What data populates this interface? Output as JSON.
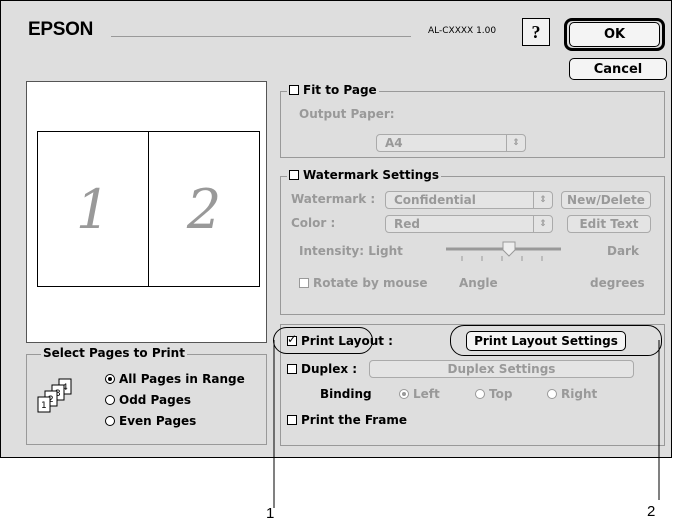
{
  "header": {
    "brand": "EPSON",
    "model": "AL-CXXXX 1.00",
    "help": "?",
    "ok": "OK",
    "cancel": "Cancel"
  },
  "preview": {
    "pages": [
      "1",
      "2"
    ]
  },
  "select_pages": {
    "title": "Select Pages to Print",
    "options": [
      {
        "label": "All Pages in Range",
        "selected": true
      },
      {
        "label": "Odd Pages",
        "selected": false
      },
      {
        "label": "Even Pages",
        "selected": false
      }
    ]
  },
  "fit_to_page": {
    "label": "Fit to Page",
    "checked": false,
    "output_paper_label": "Output Paper:",
    "output_paper_value": "A4"
  },
  "watermark": {
    "label": "Watermark Settings",
    "checked": false,
    "watermark_label": "Watermark :",
    "watermark_value": "Confidential",
    "new_delete": "New/Delete",
    "color_label": "Color :",
    "color_value": "Red",
    "edit_text": "Edit Text",
    "intensity_label": "Intensity: Light",
    "intensity_dark": "Dark",
    "intensity_level": 0.55,
    "rotate_label": "Rotate by mouse",
    "angle_label": "Angle",
    "degrees_label": "degrees"
  },
  "layout": {
    "print_layout_label": "Print Layout :",
    "print_layout_checked": true,
    "print_layout_settings": "Print Layout Settings",
    "duplex_label": "Duplex :",
    "duplex_checked": false,
    "duplex_settings": "Duplex Settings",
    "binding_label": "Binding",
    "binding_options": [
      {
        "label": "Left",
        "selected": true
      },
      {
        "label": "Top",
        "selected": false
      },
      {
        "label": "Right",
        "selected": false
      }
    ],
    "print_frame_label": "Print the Frame",
    "print_frame_checked": false
  },
  "callouts": {
    "one": "1",
    "two": "2"
  }
}
